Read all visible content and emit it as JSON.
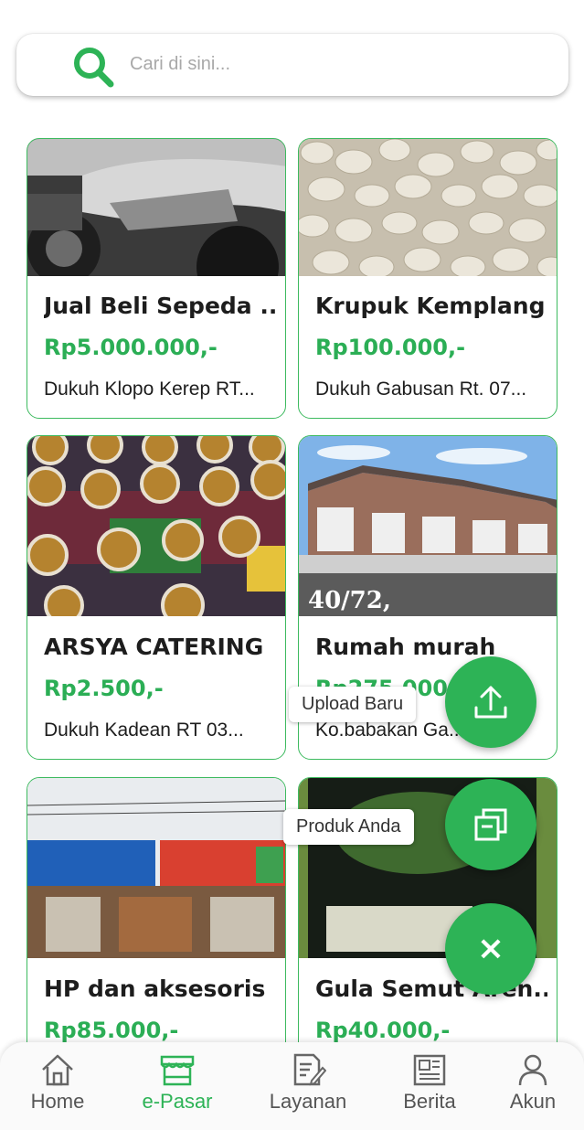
{
  "search": {
    "placeholder": "Cari di sini..."
  },
  "products": [
    {
      "title": "Jual Beli Sepeda ...",
      "price": "Rp5.000.000,-",
      "address": "Dukuh Klopo Kerep RT..."
    },
    {
      "title": "Krupuk Kemplang",
      "price": "Rp100.000,-",
      "address": "Dukuh Gabusan Rt. 07..."
    },
    {
      "title": "ARSYA CATERING",
      "price": "Rp2.500,-",
      "address": "Dukuh Kadean RT 03..."
    },
    {
      "title": "Rumah murah",
      "price": "Rp275.000,-",
      "address": "Ko.babakan Ga...",
      "image_caption": "40/72,"
    },
    {
      "title": "HP dan aksesoris",
      "price": "Rp85.000,-",
      "address": ""
    },
    {
      "title": "Gula Semut Aren...",
      "price": "Rp40.000,-",
      "address": ""
    }
  ],
  "fabs": {
    "upload_label": "Upload Baru",
    "products_label": "Produk Anda",
    "close_symbol": "×"
  },
  "nav": {
    "items": [
      {
        "label": "Home",
        "icon": "home-icon"
      },
      {
        "label": "e-Pasar",
        "icon": "market-icon",
        "active": true
      },
      {
        "label": "Layanan",
        "icon": "document-edit-icon"
      },
      {
        "label": "Berita",
        "icon": "newspaper-icon"
      },
      {
        "label": "Akun",
        "icon": "user-icon"
      }
    ]
  },
  "colors": {
    "accent": "#2db356",
    "price": "#2bae55",
    "card_border": "#3dba5f"
  }
}
